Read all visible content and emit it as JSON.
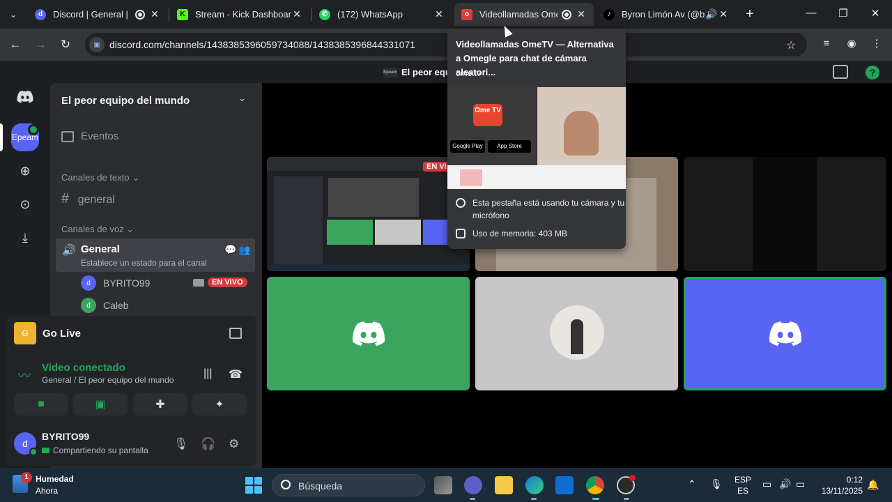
{
  "browser": {
    "tabs": [
      {
        "title": "Discord | General | El",
        "icon": "discord-icon",
        "color": "#5865f2",
        "recording": true
      },
      {
        "title": "Stream - Kick Dashboard",
        "icon": "kick-icon",
        "color": "#53fc18",
        "recording": false
      },
      {
        "title": "(172) WhatsApp",
        "icon": "whatsapp-icon",
        "color": "#25d366",
        "recording": false
      },
      {
        "title": "Videollamadas Ome",
        "icon": "ometv-icon",
        "color": "#e03c3c",
        "recording": true
      },
      {
        "title": "Byron Limón Av (@by",
        "icon": "tiktok-icon",
        "color": "#000000",
        "recording": false
      }
    ],
    "url": "discord.com/channels/1438385396059734088/1438385396844331071"
  },
  "popup": {
    "title": "Videollamadas OmeTV — Alternativa a Omegle para chat de cámara aleatori...",
    "domain": "ome.tv",
    "preview": {
      "logo": "Ome TV",
      "google_play": "Google Play",
      "app_store": "App Store"
    },
    "camera_notice": "Esta pestaña está usando tu cámara y tu micrófono",
    "memory": "Uso de memoria: 403 MB"
  },
  "discord": {
    "top_title": "El peor equipo",
    "server_name": "El peor equipo del mundo",
    "guild_label": "Epeam",
    "events": "Eventos",
    "text_category": "Canales de texto",
    "text_channel": "general",
    "voice_category": "Canales de voz",
    "voice_channel": {
      "name": "General",
      "status": "Establece un estado para el canal"
    },
    "voice_users": [
      {
        "name": "BYRITO99",
        "live": "EN VIVO"
      },
      {
        "name": "Caleb"
      }
    ],
    "go_live": {
      "title": "Go Live",
      "thumb_letter": "G"
    },
    "voice_connected": {
      "title": "Video conectado",
      "subtitle": "General / El peor equipo del mundo"
    },
    "user": {
      "name": "BYRITO99",
      "status": "Compartiendo su pantalla"
    },
    "stage": {
      "stream_badge": "EN VI"
    }
  },
  "taskbar": {
    "weather_badge": "1",
    "weather_title": "Humedad",
    "weather_sub": "Ahora",
    "search_placeholder": "Búsqueda",
    "lang_top": "ESP",
    "lang_bottom": "ES",
    "time": "0:12",
    "date": "13/11/2025"
  }
}
